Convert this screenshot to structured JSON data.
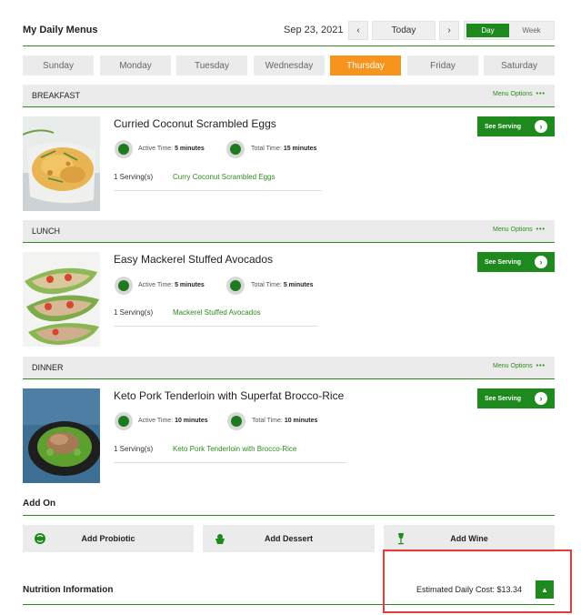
{
  "header": {
    "title": "My Daily Menus",
    "date": "Sep 23, 2021",
    "prev_label": "‹",
    "today_label": "Today",
    "next_label": "›",
    "view_day": "Day",
    "view_week": "Week"
  },
  "days": [
    "Sunday",
    "Monday",
    "Tuesday",
    "Wednesday",
    "Thursday",
    "Friday",
    "Saturday"
  ],
  "active_day": "Thursday",
  "menu_options_label": "Menu Options",
  "meals": [
    {
      "section": "BREAKFAST",
      "title": "Curried Coconut Scrambled Eggs",
      "active_label": "Active Time:",
      "active_time": "5 minutes",
      "total_label": "Total Time:",
      "total_time": "15 minutes",
      "servings": "1 Serving(s)",
      "recipe_link": "Curry Coconut Scrambled Eggs",
      "button": "See Serving"
    },
    {
      "section": "LUNCH",
      "title": "Easy Mackerel Stuffed Avocados",
      "active_label": "Active Time:",
      "active_time": "5 minutes",
      "total_label": "Total Time:",
      "total_time": "5 minutes",
      "servings": "1 Serving(s)",
      "recipe_link": "Mackerel Stuffed Avocados",
      "button": "See Serving"
    },
    {
      "section": "DINNER",
      "title": "Keto Pork Tenderloin with Superfat Brocco-Rice",
      "active_label": "Active Time:",
      "active_time": "10 minutes",
      "total_label": "Total Time:",
      "total_time": "10 minutes",
      "servings": "1 Serving(s)",
      "recipe_link": "Keto Pork Tenderloin with Brocco-Rice",
      "button": "See Serving"
    }
  ],
  "addon": {
    "title": "Add On",
    "buttons": [
      "Add Probiotic",
      "Add Dessert",
      "Add Wine"
    ]
  },
  "footer": {
    "nutrition": "Nutrition Information",
    "cost": "Estimated Daily Cost: $13.34",
    "up_icon": "chevron-up-icon"
  },
  "colors": {
    "green": "#1e8a1e",
    "orange": "#f7941d",
    "highlight": "#e23b3b"
  }
}
